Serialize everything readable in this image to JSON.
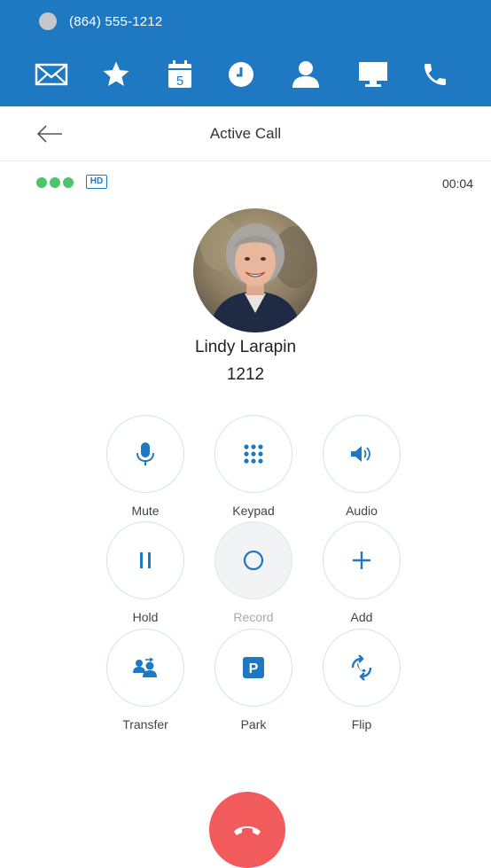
{
  "header": {
    "phone_number": "(864) 555-1212",
    "status_color": "#c4c8cc",
    "brand_color": "#1e78c2",
    "nav_icons": [
      "mail-icon",
      "star-icon",
      "calendar-icon",
      "clock-icon",
      "contact-icon",
      "desktop-icon",
      "phone-icon"
    ],
    "calendar_day": "5"
  },
  "title_bar": {
    "title": "Active Call",
    "back_icon": "back-arrow-icon"
  },
  "call": {
    "hd_label": "HD",
    "timer": "00:04",
    "signal_color": "#4cc46a"
  },
  "contact": {
    "name": "Lindy Larapin",
    "extension": "1212"
  },
  "controls": {
    "mute": "Mute",
    "keypad": "Keypad",
    "audio": "Audio",
    "hold": "Hold",
    "record": "Record",
    "add": "Add",
    "transfer": "Transfer",
    "park": "Park",
    "park_icon_letter": "P",
    "flip": "Flip"
  },
  "hangup": {
    "color": "#f15b5b",
    "icon": "hangup-icon"
  }
}
